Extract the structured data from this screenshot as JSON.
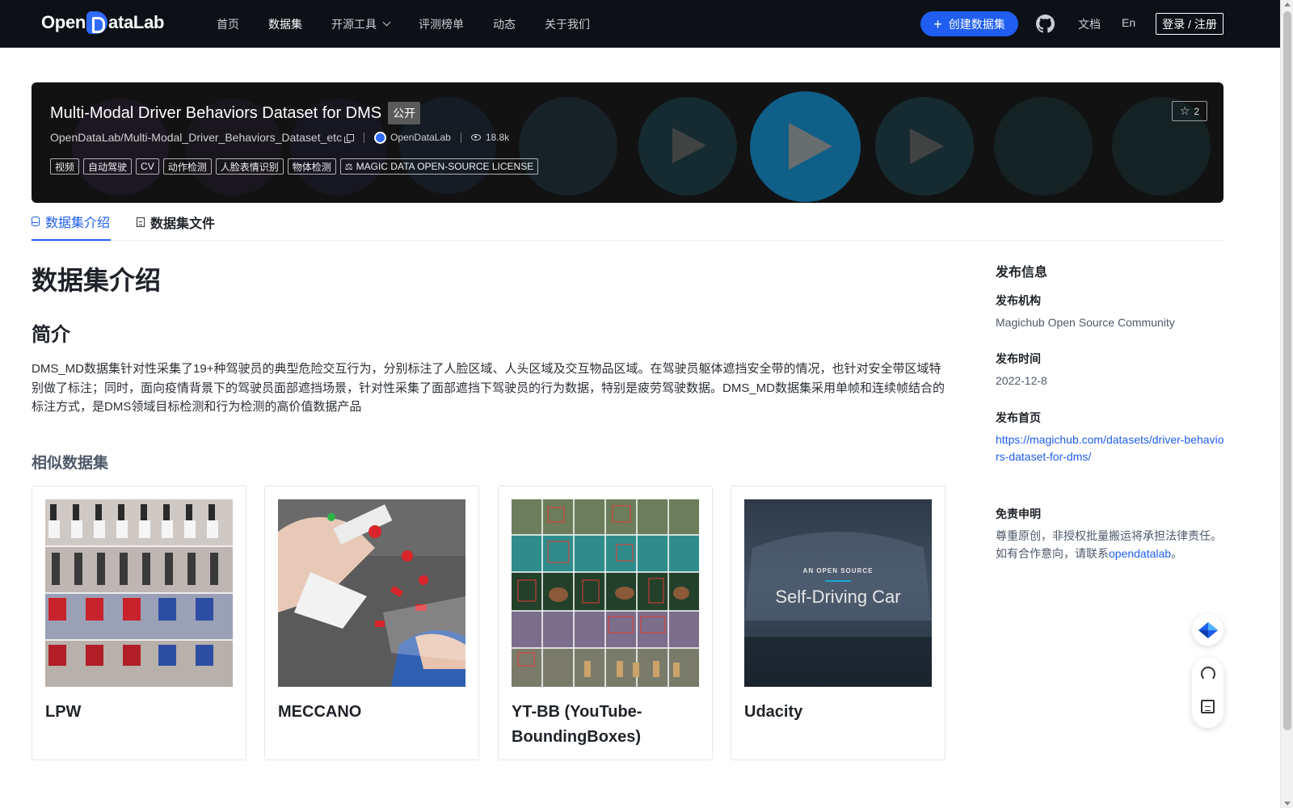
{
  "nav": {
    "logo_text_left": "Open",
    "logo_text_right": "ataLab",
    "links": [
      "首页",
      "数据集",
      "开源工具",
      "评测榜单",
      "动态",
      "关于我们"
    ],
    "create_button": "创建数据集",
    "docs": "文档",
    "lang": "En",
    "login": "登录 / 注册"
  },
  "banner": {
    "title": "Multi-Modal Driver Behaviors Dataset for DMS",
    "visibility": "公开",
    "repo": "OpenDataLab/Multi-Modal_Driver_Behaviors_Dataset_etc",
    "org": "OpenDataLab",
    "views": "18.8k",
    "tags": [
      "视频",
      "自动驾驶",
      "CV",
      "动作检测",
      "人脸表情识别",
      "物体检测"
    ],
    "license": "MAGIC DATA OPEN-SOURCE LICENSE",
    "stars": "2"
  },
  "tabs": [
    "数据集介绍",
    "数据集文件"
  ],
  "main": {
    "heading": "数据集介绍",
    "subheading": "简介",
    "intro": "DMS_MD数据集针对性采集了19+种驾驶员的典型危险交互行为，分别标注了人脸区域、人头区域及交互物品区域。在驾驶员躯体遮挡安全带的情况，也针对安全带区域特别做了标注；同时，面向疫情背景下的驾驶员面部遮挡场景，针对性采集了面部遮挡下驾驶员的行为数据，特别是疲劳驾驶数据。DMS_MD数据集采用单帧和连续帧结合的标注方式，是DMS领域目标检测和行为检测的高价值数据产品",
    "similar_heading": "相似数据集",
    "similar": [
      {
        "name": "LPW"
      },
      {
        "name": "MECCANO"
      },
      {
        "name": "YT-BB (YouTube-BoundingBoxes)"
      },
      {
        "name": "Udacity",
        "image_text_small": "AN OPEN SOURCE",
        "image_text_large": "Self-Driving Car"
      }
    ]
  },
  "sidebar": {
    "title": "发布信息",
    "org_label": "发布机构",
    "org_value": "Magichub Open Source Community",
    "date_label": "发布时间",
    "date_value": "2022-12-8",
    "home_label": "发布首页",
    "home_value": "https://magichub.com/datasets/driver-behaviors-dataset-for-dms/",
    "disclaimer_label": "免责申明",
    "disclaimer_line1": "尊重原创，非授权批量搬运将承担法律责任。",
    "disclaimer_line2_prefix": "如有合作意向，请联系",
    "disclaimer_link": "opendatalab",
    "disclaimer_suffix": "。"
  },
  "colors": {
    "nav_bg": "#0d1117",
    "accent": "#1f5ef0",
    "banner_bg": "#121212"
  }
}
